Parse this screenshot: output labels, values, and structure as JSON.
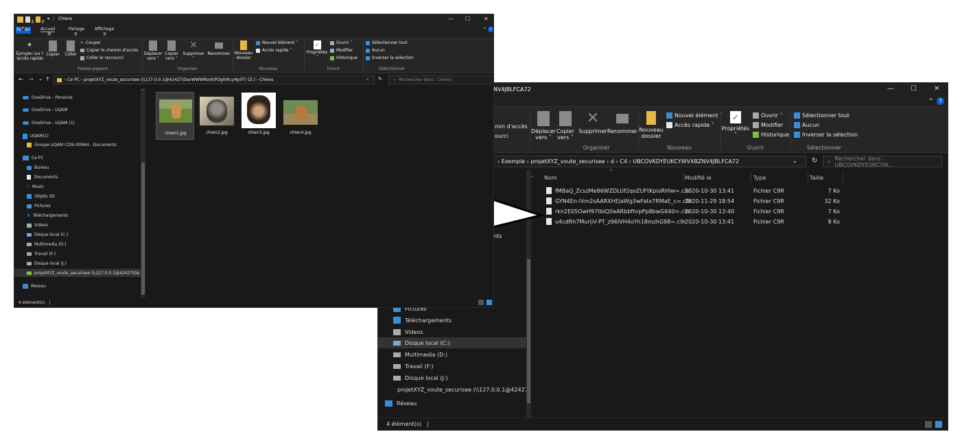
{
  "win1": {
    "title": "Chiens",
    "tabs": [
      {
        "label": "Fichier",
        "key": "F"
      },
      {
        "label": "Accueil",
        "key": "H"
      },
      {
        "label": "Partage",
        "key": "S"
      },
      {
        "label": "Affichage",
        "key": "V"
      }
    ],
    "quick_keys": [
      "1",
      "2"
    ],
    "ribbon": {
      "pin": "Épingler sur l",
      "pin2": "'accès rapide",
      "copy": "Copier",
      "paste": "Coller",
      "cut": "Couper",
      "copy_path": "Copier le chemin d'accès",
      "paste_shortcut": "Coller le raccourci",
      "move": "Déplacer",
      "move2": "vers ˅",
      "copyto": "Copier",
      "copyto2": "vers ˅",
      "delete": "Supprimer",
      "rename": "Renommer",
      "newfolder": "Nouveau",
      "newfolder2": "dossier",
      "newitem": "Nouvel élément ˅",
      "quickaccess": "Accès rapide ˅",
      "properties": "Propriétés",
      "open": "Ouvrir ˅",
      "edit": "Modifier",
      "history": "Historique",
      "selectall": "Sélectionner tout",
      "none": "Aucun",
      "invert": "Inverser la sélection",
      "groups": [
        "Presse-papiers",
        "Organiser",
        "Nouveau",
        "Ouvrir",
        "Sélectionner"
      ]
    },
    "address": [
      "Ce PC",
      "projetXYZ_voute_securisee (\\\\127.0.0.1@42427\\DavWWWRoot\\POgIVKcyNy0T) (Z:)",
      "Chiens"
    ],
    "search_placeholder": "Rechercher dans : Chiens",
    "nav": [
      "OneDrive - Personal",
      "OneDrive - UQAM",
      "OneDrive - UQAM (1)",
      "UQAM(1)",
      "Groupe UQAM CDSI-90964 - Documents",
      "Ce PC",
      "Bureau",
      "Documents",
      "Music",
      "Objets 3D",
      "Pictures",
      "Téléchargements",
      "Videos",
      "Disque local (C:)",
      "Multimedia (D:)",
      "Travail (F:)",
      "Disque local (J:)",
      "projetXYZ_voute_securisee (\\\\127.0.0.1@42427\\Da",
      "Réseau"
    ],
    "files": [
      "chien1.jpg",
      "chien2.jpg",
      "chien3.jpg",
      "chien4.jpg"
    ],
    "status": "4 élément(s)"
  },
  "win2": {
    "title": "NV4JBLFCA72",
    "ribbon": {
      "copy_path_partial": "min d'accès",
      "shortcut_partial": "ourci",
      "move": "Déplacer",
      "move2": "vers ˅",
      "copyto": "Copier",
      "copyto2": "vers ˅",
      "delete": "Supprimer",
      "rename": "Renommer",
      "newfolder": "Nouveau",
      "newfolder2": "dossier",
      "newitem": "Nouvel élément ˅",
      "quickaccess": "Accès rapide ˅",
      "properties": "Propriétés",
      "open": "Ouvrir ˅",
      "edit": "Modifier",
      "history": "Historique",
      "selectall": "Sélectionner tout",
      "none": "Aucun",
      "invert": "Inverser la sélection",
      "groups": [
        "Organiser",
        "Nouveau",
        "Ouvrir",
        "Sélectionner"
      ]
    },
    "address": [
      "Exemple",
      "projetXYZ_voute_securisee",
      "d",
      "C4",
      "UBCOVKDYEUKCYWVXBZNV4JBLFCA72"
    ],
    "search_placeholder": "Rechercher dans : UBCOVKDYEUKCYW...",
    "columns": [
      "Nom",
      "Modifié le",
      "Type",
      "Taille"
    ],
    "files": [
      {
        "name": "fMBaQ_ZcszMe86WZDLUf2qoZUFtKpioRHlw=.c9r",
        "date": "2020-10-30 13:41",
        "type": "Fichier C9R",
        "size": "7 Ko"
      },
      {
        "name": "GYN4En-iVm2sAARXHEjaWg3wFatx7RMaE_c=.c9r",
        "date": "2020-11-29 18:54",
        "type": "Fichier C9R",
        "size": "32 Ko"
      },
      {
        "name": "rkn2E05OwH97tblQ0aARbbfhrpPp8bwG640=.c9r",
        "date": "2020-10-30 13:40",
        "type": "Fichier C9R",
        "size": "7 Ko"
      },
      {
        "name": "u4cdRh7MurljV-PT_z96lVH4oYh18mzhG98=.c9r",
        "date": "2020-10-30 13:41",
        "type": "Fichier C9R",
        "size": "8 Ko"
      }
    ],
    "nav_partial": "nts",
    "nav": [
      "Pictures",
      "Téléchargements",
      "Videos",
      "Disque local (C:)",
      "Multimedia (D:)",
      "Travail (F:)",
      "Disque local (J:)",
      "projetXYZ_voute_securisee (\\\\127.0.0.1@42427\\Da",
      "Réseau"
    ],
    "status": "4 élément(s)"
  },
  "icons": {
    "minimize": "—",
    "maximize": "☐",
    "close": "✕",
    "back": "←",
    "forward": "→",
    "up": "↑",
    "dropdown": "⌄",
    "refresh": "↻",
    "search": "⌕",
    "chevron_up": "^",
    "help": "?",
    "breadcrumb_sep": "›"
  },
  "colors": {
    "accent": "#0a64d6",
    "bg": "#191919",
    "arrow_fill": "#ffffff",
    "arrow_stroke": "#000000"
  }
}
